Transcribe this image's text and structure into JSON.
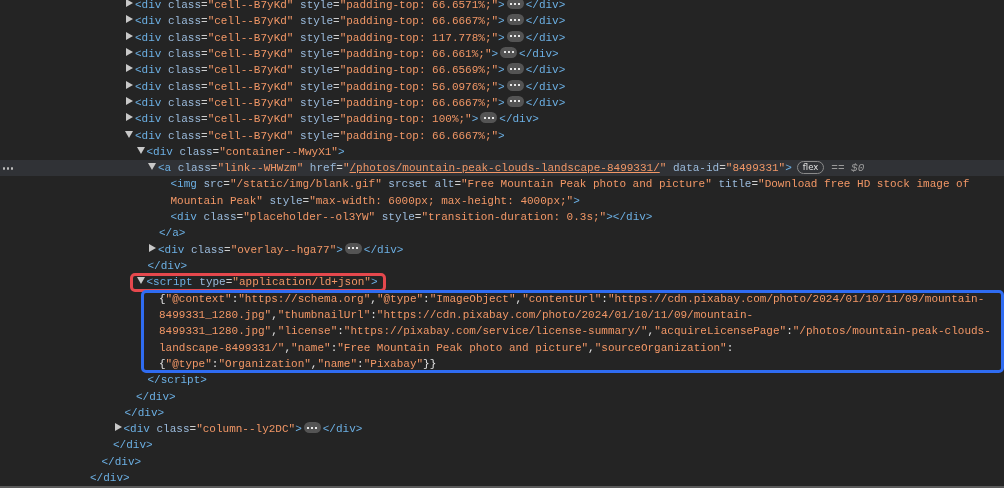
{
  "tree": [
    {
      "close": [
        {
          "kind": "tag",
          "text": "</div>"
        }
      ],
      "children": [
        {
          "close": [
            {
              "kind": "tag",
              "text": "</div>"
            }
          ],
          "children": [
            {
              "close": [
                {
                  "kind": "tag",
                  "text": "</div>"
                }
              ],
              "children": [
                {
                  "close": [
                    {
                      "kind": "tag",
                      "text": "</div>"
                    }
                  ],
                  "children": [
                    {
                      "selected": false,
                      "expanded": false,
                      "open": [
                        {
                          "kind": "tag",
                          "text": "<div"
                        },
                        {
                          "kind": "attr",
                          "text": " class"
                        },
                        {
                          "kind": "punct",
                          "text": "="
                        },
                        {
                          "kind": "value",
                          "text": "\"cell--B7yKd\""
                        },
                        {
                          "kind": "attr",
                          "text": " style"
                        },
                        {
                          "kind": "punct",
                          "text": "="
                        },
                        {
                          "kind": "value",
                          "text": "\"padding-top: 66.6571%;\""
                        },
                        {
                          "kind": "tag",
                          "text": ">"
                        }
                      ],
                      "close": [
                        {
                          "kind": "tag",
                          "text": "</div>"
                        }
                      ]
                    },
                    {
                      "selected": false,
                      "expanded": false,
                      "open": [
                        {
                          "kind": "tag",
                          "text": "<div"
                        },
                        {
                          "kind": "attr",
                          "text": " class"
                        },
                        {
                          "kind": "punct",
                          "text": "="
                        },
                        {
                          "kind": "value",
                          "text": "\"cell--B7yKd\""
                        },
                        {
                          "kind": "attr",
                          "text": " style"
                        },
                        {
                          "kind": "punct",
                          "text": "="
                        },
                        {
                          "kind": "value",
                          "text": "\"padding-top: 66.6667%;\""
                        },
                        {
                          "kind": "tag",
                          "text": ">"
                        }
                      ],
                      "close": [
                        {
                          "kind": "tag",
                          "text": "</div>"
                        }
                      ]
                    },
                    {
                      "selected": false,
                      "expanded": false,
                      "open": [
                        {
                          "kind": "tag",
                          "text": "<div"
                        },
                        {
                          "kind": "attr",
                          "text": " class"
                        },
                        {
                          "kind": "punct",
                          "text": "="
                        },
                        {
                          "kind": "value",
                          "text": "\"cell--B7yKd\""
                        },
                        {
                          "kind": "attr",
                          "text": " style"
                        },
                        {
                          "kind": "punct",
                          "text": "="
                        },
                        {
                          "kind": "value",
                          "text": "\"padding-top: 117.778%;\""
                        },
                        {
                          "kind": "tag",
                          "text": ">"
                        }
                      ],
                      "close": [
                        {
                          "kind": "tag",
                          "text": "</div>"
                        }
                      ]
                    },
                    {
                      "selected": false,
                      "expanded": false,
                      "open": [
                        {
                          "kind": "tag",
                          "text": "<div"
                        },
                        {
                          "kind": "attr",
                          "text": " class"
                        },
                        {
                          "kind": "punct",
                          "text": "="
                        },
                        {
                          "kind": "value",
                          "text": "\"cell--B7yKd\""
                        },
                        {
                          "kind": "attr",
                          "text": " style"
                        },
                        {
                          "kind": "punct",
                          "text": "="
                        },
                        {
                          "kind": "value",
                          "text": "\"padding-top: 66.661%;\""
                        },
                        {
                          "kind": "tag",
                          "text": ">"
                        }
                      ],
                      "close": [
                        {
                          "kind": "tag",
                          "text": "</div>"
                        }
                      ]
                    },
                    {
                      "selected": false,
                      "expanded": false,
                      "open": [
                        {
                          "kind": "tag",
                          "text": "<div"
                        },
                        {
                          "kind": "attr",
                          "text": " class"
                        },
                        {
                          "kind": "punct",
                          "text": "="
                        },
                        {
                          "kind": "value",
                          "text": "\"cell--B7yKd\""
                        },
                        {
                          "kind": "attr",
                          "text": " style"
                        },
                        {
                          "kind": "punct",
                          "text": "="
                        },
                        {
                          "kind": "value",
                          "text": "\"padding-top: 66.6569%;\""
                        },
                        {
                          "kind": "tag",
                          "text": ">"
                        }
                      ],
                      "close": [
                        {
                          "kind": "tag",
                          "text": "</div>"
                        }
                      ]
                    },
                    {
                      "selected": false,
                      "expanded": false,
                      "open": [
                        {
                          "kind": "tag",
                          "text": "<div"
                        },
                        {
                          "kind": "attr",
                          "text": " class"
                        },
                        {
                          "kind": "punct",
                          "text": "="
                        },
                        {
                          "kind": "value",
                          "text": "\"cell--B7yKd\""
                        },
                        {
                          "kind": "attr",
                          "text": " style"
                        },
                        {
                          "kind": "punct",
                          "text": "="
                        },
                        {
                          "kind": "value",
                          "text": "\"padding-top: 56.0976%;\""
                        },
                        {
                          "kind": "tag",
                          "text": ">"
                        }
                      ],
                      "close": [
                        {
                          "kind": "tag",
                          "text": "</div>"
                        }
                      ]
                    },
                    {
                      "selected": false,
                      "expanded": false,
                      "open": [
                        {
                          "kind": "tag",
                          "text": "<div"
                        },
                        {
                          "kind": "attr",
                          "text": " class"
                        },
                        {
                          "kind": "punct",
                          "text": "="
                        },
                        {
                          "kind": "value",
                          "text": "\"cell--B7yKd\""
                        },
                        {
                          "kind": "attr",
                          "text": " style"
                        },
                        {
                          "kind": "punct",
                          "text": "="
                        },
                        {
                          "kind": "value",
                          "text": "\"padding-top: 66.6667%;\""
                        },
                        {
                          "kind": "tag",
                          "text": ">"
                        }
                      ],
                      "close": [
                        {
                          "kind": "tag",
                          "text": "</div>"
                        }
                      ]
                    },
                    {
                      "selected": false,
                      "expanded": false,
                      "open": [
                        {
                          "kind": "tag",
                          "text": "<div"
                        },
                        {
                          "kind": "attr",
                          "text": " class"
                        },
                        {
                          "kind": "punct",
                          "text": "="
                        },
                        {
                          "kind": "value",
                          "text": "\"cell--B7yKd\""
                        },
                        {
                          "kind": "attr",
                          "text": " style"
                        },
                        {
                          "kind": "punct",
                          "text": "="
                        },
                        {
                          "kind": "value",
                          "text": "\"padding-top: 100%;\""
                        },
                        {
                          "kind": "tag",
                          "text": ">"
                        }
                      ],
                      "close": [
                        {
                          "kind": "tag",
                          "text": "</div>"
                        }
                      ]
                    },
                    {
                      "selected": false,
                      "expanded": true,
                      "open": [
                        {
                          "kind": "tag",
                          "text": "<div"
                        },
                        {
                          "kind": "attr",
                          "text": " class"
                        },
                        {
                          "kind": "punct",
                          "text": "="
                        },
                        {
                          "kind": "value",
                          "text": "\"cell--B7yKd\""
                        },
                        {
                          "kind": "attr",
                          "text": " style"
                        },
                        {
                          "kind": "punct",
                          "text": "="
                        },
                        {
                          "kind": "value",
                          "text": "\"padding-top: 66.6667%;\""
                        },
                        {
                          "kind": "tag",
                          "text": ">"
                        }
                      ],
                      "close": [
                        {
                          "kind": "tag",
                          "text": "</div>"
                        }
                      ],
                      "children": [
                        {
                          "selected": false,
                          "expanded": true,
                          "open": [
                            {
                              "kind": "tag",
                              "text": "<div"
                            },
                            {
                              "kind": "attr",
                              "text": " class"
                            },
                            {
                              "kind": "punct",
                              "text": "="
                            },
                            {
                              "kind": "value",
                              "text": "\"container--MwyX1\""
                            },
                            {
                              "kind": "tag",
                              "text": ">"
                            }
                          ],
                          "close": [
                            {
                              "kind": "tag",
                              "text": "</div>"
                            }
                          ],
                          "children": [
                            {
                              "selected": true,
                              "expanded": true,
                              "open": [
                                {
                                  "kind": "tag",
                                  "text": "<a"
                                },
                                {
                                  "kind": "attr",
                                  "text": " class"
                                },
                                {
                                  "kind": "punct",
                                  "text": "="
                                },
                                {
                                  "kind": "value",
                                  "text": "\"link--WHWzm\""
                                },
                                {
                                  "kind": "attr",
                                  "text": " href"
                                },
                                {
                                  "kind": "punct",
                                  "text": "="
                                },
                                {
                                  "kind": "value",
                                  "text": "\""
                                },
                                {
                                  "kind": "link",
                                  "text": "/photos/mountain-peak-clouds-landscape-8499331/"
                                },
                                {
                                  "kind": "value",
                                  "text": "\""
                                },
                                {
                                  "kind": "attr",
                                  "text": " data-id"
                                },
                                {
                                  "kind": "punct",
                                  "text": "="
                                },
                                {
                                  "kind": "value",
                                  "text": "\"8499331\""
                                },
                                {
                                  "kind": "tag",
                                  "text": ">"
                                }
                              ],
                              "badge": "flex",
                              "note": "== $0",
                              "close": [
                                {
                                  "kind": "tag",
                                  "text": "</a>"
                                }
                              ],
                              "children": [
                                {
                                  "selected": false,
                                  "open": [
                                    {
                                      "kind": "tag",
                                      "text": "<img"
                                    },
                                    {
                                      "kind": "attr",
                                      "text": " src"
                                    },
                                    {
                                      "kind": "punct",
                                      "text": "="
                                    },
                                    {
                                      "kind": "value",
                                      "text": "\"/static/img/blank.gif\""
                                    },
                                    {
                                      "kind": "attr",
                                      "text": " srcset"
                                    },
                                    {
                                      "kind": "attr",
                                      "text": " alt"
                                    },
                                    {
                                      "kind": "punct",
                                      "text": "="
                                    },
                                    {
                                      "kind": "value",
                                      "text": "\"Free Mountain Peak photo and picture\""
                                    },
                                    {
                                      "kind": "attr",
                                      "text": " title"
                                    },
                                    {
                                      "kind": "punct",
                                      "text": "="
                                    },
                                    {
                                      "kind": "value",
                                      "text": "\"Download free HD stock image of Mountain Peak\""
                                    },
                                    {
                                      "kind": "attr",
                                      "text": " style"
                                    },
                                    {
                                      "kind": "punct",
                                      "text": "="
                                    },
                                    {
                                      "kind": "value",
                                      "text": "\"max-width: 6000px; max-height: 4000px;\""
                                    },
                                    {
                                      "kind": "tag",
                                      "text": ">"
                                    }
                                  ]
                                },
                                {
                                  "selected": false,
                                  "open": [
                                    {
                                      "kind": "tag",
                                      "text": "<div"
                                    },
                                    {
                                      "kind": "attr",
                                      "text": " class"
                                    },
                                    {
                                      "kind": "punct",
                                      "text": "="
                                    },
                                    {
                                      "kind": "value",
                                      "text": "\"placeholder--ol3YW\""
                                    },
                                    {
                                      "kind": "attr",
                                      "text": " style"
                                    },
                                    {
                                      "kind": "punct",
                                      "text": "="
                                    },
                                    {
                                      "kind": "value",
                                      "text": "\"transition-duration: 0.3s;\""
                                    },
                                    {
                                      "kind": "tag",
                                      "text": ">"
                                    }
                                  ],
                                  "close": [
                                    {
                                      "kind": "tag",
                                      "text": "</div>"
                                    }
                                  ]
                                }
                              ]
                            },
                            {
                              "selected": false,
                              "expanded": false,
                              "open": [
                                {
                                  "kind": "tag",
                                  "text": "<div"
                                },
                                {
                                  "kind": "attr",
                                  "text": " class"
                                },
                                {
                                  "kind": "punct",
                                  "text": "="
                                },
                                {
                                  "kind": "value",
                                  "text": "\"overlay--hga77\""
                                },
                                {
                                  "kind": "tag",
                                  "text": ">"
                                }
                              ],
                              "close": [
                                {
                                  "kind": "tag",
                                  "text": "</div>"
                                }
                              ]
                            }
                          ]
                        },
                        {
                          "selected": false,
                          "expanded": true,
                          "color": "#e5484d",
                          "open": [
                            {
                              "kind": "tag",
                              "text": "<script"
                            },
                            {
                              "kind": "attr",
                              "text": " type"
                            },
                            {
                              "kind": "punct",
                              "text": "="
                            },
                            {
                              "kind": "value",
                              "text": "\"application/ld+json\""
                            },
                            {
                              "kind": "tag",
                              "text": ">"
                            }
                          ],
                          "close": [
                            {
                              "kind": "tag",
                              "text": "</script>"
                            }
                          ],
                          "children": [
                            {
                              "selected": false,
                              "color": "#2f6cf2",
                              "text": [
                                {
                                  "kind": "json",
                                  "text": "{"
                                },
                                {
                                  "kind": "string",
                                  "text": "\"@context\""
                                },
                                {
                                  "kind": "json",
                                  "text": ":"
                                },
                                {
                                  "kind": "string",
                                  "text": "\"https://schema.org\""
                                },
                                {
                                  "kind": "json",
                                  "text": ","
                                },
                                {
                                  "kind": "string",
                                  "text": "\"@type\""
                                },
                                {
                                  "kind": "json",
                                  "text": ":"
                                },
                                {
                                  "kind": "string",
                                  "text": "\"ImageObject\""
                                },
                                {
                                  "kind": "json",
                                  "text": ","
                                },
                                {
                                  "kind": "string",
                                  "text": "\"contentUrl\""
                                },
                                {
                                  "kind": "json",
                                  "text": ":"
                                },
                                {
                                  "kind": "string",
                                  "text": "\"https://cdn.pixabay.com/photo/2024/01/10/11/09/mountain-8499331_1280.jpg\""
                                },
                                {
                                  "kind": "json",
                                  "text": ","
                                },
                                {
                                  "kind": "string",
                                  "text": "\"thumbnailUrl\""
                                },
                                {
                                  "kind": "json",
                                  "text": ":"
                                },
                                {
                                  "kind": "string",
                                  "text": "\"https://cdn.pixabay.com/photo/2024/01/10/11/09/mountain-8499331_1280.jpg\""
                                },
                                {
                                  "kind": "json",
                                  "text": ","
                                },
                                {
                                  "kind": "string",
                                  "text": "\"license\""
                                },
                                {
                                  "kind": "json",
                                  "text": ":"
                                },
                                {
                                  "kind": "string",
                                  "text": "\"https://pixabay.com/service/license-summary/\""
                                },
                                {
                                  "kind": "json",
                                  "text": ","
                                },
                                {
                                  "kind": "string",
                                  "text": "\"acquireLicensePage\""
                                },
                                {
                                  "kind": "json",
                                  "text": ":"
                                },
                                {
                                  "kind": "string",
                                  "text": "\"/photos/mountain-peak-clouds-landscape-8499331/\""
                                },
                                {
                                  "kind": "json",
                                  "text": ","
                                },
                                {
                                  "kind": "string",
                                  "text": "\"name\""
                                },
                                {
                                  "kind": "json",
                                  "text": ":"
                                },
                                {
                                  "kind": "string",
                                  "text": "\"Free Mountain Peak photo and picture\""
                                },
                                {
                                  "kind": "json",
                                  "text": ","
                                },
                                {
                                  "kind": "string",
                                  "text": "\"sourceOrganization\""
                                },
                                {
                                  "kind": "json",
                                  "text": ": "
                                },
                                {
                                  "kind": "json",
                                  "text": "{"
                                },
                                {
                                  "kind": "string",
                                  "text": "\"@type\""
                                },
                                {
                                  "kind": "json",
                                  "text": ":"
                                },
                                {
                                  "kind": "string",
                                  "text": "\"Organization\""
                                },
                                {
                                  "kind": "json",
                                  "text": ","
                                },
                                {
                                  "kind": "string",
                                  "text": "\"name\""
                                },
                                {
                                  "kind": "json",
                                  "text": ":"
                                },
                                {
                                  "kind": "string",
                                  "text": "\"Pixabay\""
                                },
                                {
                                  "kind": "json",
                                  "text": "}}"
                                }
                              ]
                            }
                          ]
                        }
                      ]
                    }
                  ]
                },
                {
                  "selected": false,
                  "expanded": false,
                  "open": [
                    {
                      "kind": "tag",
                      "text": "<div"
                    },
                    {
                      "kind": "attr",
                      "text": " class"
                    },
                    {
                      "kind": "punct",
                      "text": "="
                    },
                    {
                      "kind": "value",
                      "text": "\"column--ly2DC\""
                    },
                    {
                      "kind": "tag",
                      "text": ">"
                    }
                  ],
                  "close": [
                    {
                      "kind": "tag",
                      "text": "</div>"
                    }
                  ]
                }
              ]
            }
          ]
        }
      ]
    }
  ]
}
